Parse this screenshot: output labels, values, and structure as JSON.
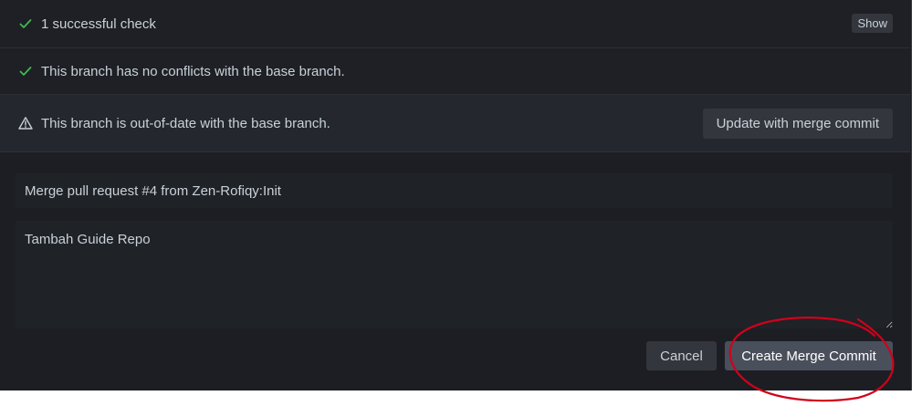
{
  "checks": {
    "successful_label": "1 successful check",
    "show_label": "Show",
    "conflicts_label": "This branch has no conflicts with the base branch."
  },
  "out_of_date": {
    "label": "This branch is out-of-date with the base branch.",
    "update_label": "Update with merge commit"
  },
  "merge_form": {
    "title_value": "Merge pull request #4 from Zen-Rofiqy:Init",
    "body_value": "Tambah Guide Repo",
    "cancel_label": "Cancel",
    "submit_label": "Create Merge Commit"
  },
  "icons": {
    "check": "check-icon",
    "warning": "alert-icon"
  },
  "colors": {
    "success": "#3fb950",
    "annotation": "#d0021b"
  }
}
